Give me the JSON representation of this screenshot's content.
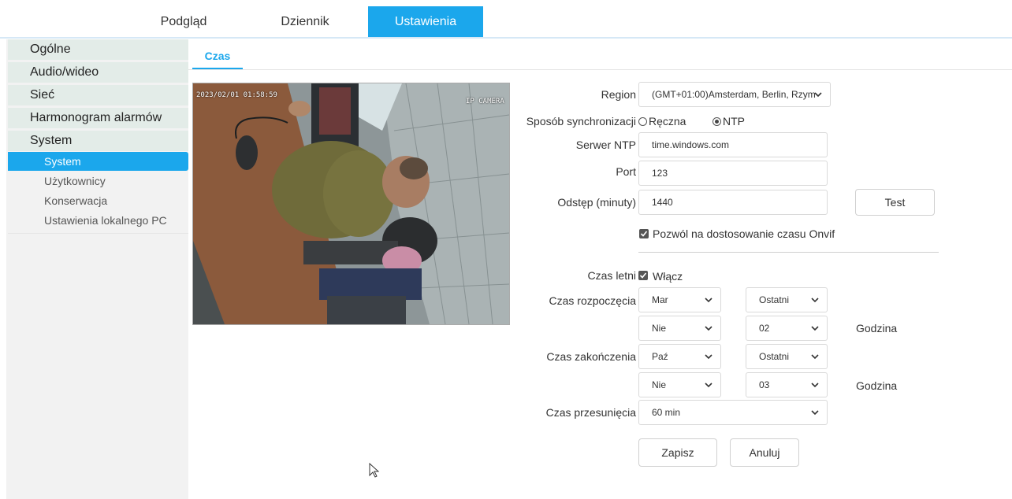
{
  "nav": {
    "tabs": [
      {
        "label": "Podgląd"
      },
      {
        "label": "Dziennik"
      },
      {
        "label": "Ustawienia"
      }
    ]
  },
  "sidebar": {
    "groups": [
      {
        "label": "Ogólne"
      },
      {
        "label": "Audio/wideo"
      },
      {
        "label": "Sieć"
      },
      {
        "label": "Harmonogram alarmów"
      },
      {
        "label": "System"
      }
    ],
    "subitems": [
      {
        "label": "System"
      },
      {
        "label": "Użytkownicy"
      },
      {
        "label": "Konserwacja"
      },
      {
        "label": "Ustawienia lokalnego PC"
      }
    ]
  },
  "main": {
    "subtab": "Czas",
    "camera": {
      "timestamp": "2023/02/01 01:58:59",
      "channel": "IP CAMERA"
    },
    "form": {
      "region_label": "Region",
      "region_value": "(GMT+01:00)Amsterdam, Berlin, Rzym",
      "sync_label": "Sposób synchronizacji",
      "sync_manual": "Ręczna",
      "sync_ntp": "NTP",
      "ntp_server_label": "Serwer NTP",
      "ntp_server_value": "time.windows.com",
      "port_label": "Port",
      "port_value": "123",
      "interval_label": "Odstęp (minuty)",
      "interval_value": "1440",
      "test_button": "Test",
      "onvif_label": "Pozwól na dostosowanie czasu Onvif",
      "dst_label": "Czas letni",
      "dst_enable": "Włącz",
      "start_label": "Czas rozpoczęcia",
      "start_month": "Mar",
      "start_week": "Ostatni",
      "start_day": "Nie",
      "start_hour": "02",
      "hour_suffix": "Godzina",
      "end_label": "Czas zakończenia",
      "end_month": "Paź",
      "end_week": "Ostatni",
      "end_day": "Nie",
      "end_hour": "03",
      "offset_label": "Czas przesunięcia",
      "offset_value": "60 min",
      "save_button": "Zapisz",
      "cancel_button": "Anuluj"
    }
  },
  "colors": {
    "accent": "#1ba7ec",
    "sidebar_bg": "#f2f2f2",
    "group_bg": "#e3ece8"
  }
}
